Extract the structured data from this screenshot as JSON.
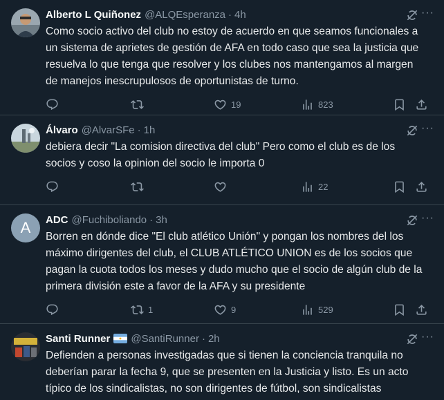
{
  "tweets": [
    {
      "name": "Alberto L Quiñonez",
      "handle": "@ALQEsperanza",
      "time": "4h",
      "text": "Como socio activo del club no estoy de acuerdo en que seamos funcionales a un sistema de aprietes de gestión de AFA en todo caso que sea la justicia que resuelva lo que tenga que resolver y los clubes nos mantengamos al margen de manejos inescrupulosos de oportunistas de turno.",
      "replies": "",
      "retweets": "",
      "likes": "19",
      "views": "823"
    },
    {
      "name": "Álvaro",
      "handle": "@AlvarSFe",
      "time": "1h",
      "text": "debiera decir \"La comision directiva del club\" Pero como el club es de los socios y coso la opinion del socio le importa 0",
      "replies": "",
      "retweets": "",
      "likes": "",
      "views": "22"
    },
    {
      "name": "ADC",
      "handle": "@Fuchiboliando",
      "time": "3h",
      "avatar_letter": "A",
      "text": "Borren en dónde dice \"El club atlético Unión\" y pongan los nombres del los máximo dirigentes del club, el CLUB ATLÉTICO UNION es de los socios que pagan la cuota todos los meses y dudo mucho que el socio de algún club de la primera división este a favor de la AFA y su presidente",
      "replies": "",
      "retweets": "1",
      "likes": "9",
      "views": "529"
    },
    {
      "name": "Santi Runner",
      "handle": "@SantiRunner",
      "time": "2h",
      "text": "Defienden a personas investigadas que si tienen la conciencia tranquila no deberían parar la fecha 9, que se presenten en la Justicia y listo. Es un acto típico de los sindicalistas, no son dirigentes de fútbol, son sindicalistas"
    }
  ],
  "dot": "·",
  "more": "···",
  "icons": {
    "grok": "grok-icon",
    "reply": "reply-icon",
    "retweet": "retweet-icon",
    "like": "heart-icon",
    "views": "views-icon",
    "bookmark": "bookmark-icon",
    "share": "share-icon"
  },
  "colors": {
    "background": "#15202b",
    "text": "#e7e9ea",
    "muted": "#8b98a5",
    "divider": "#38444d"
  }
}
